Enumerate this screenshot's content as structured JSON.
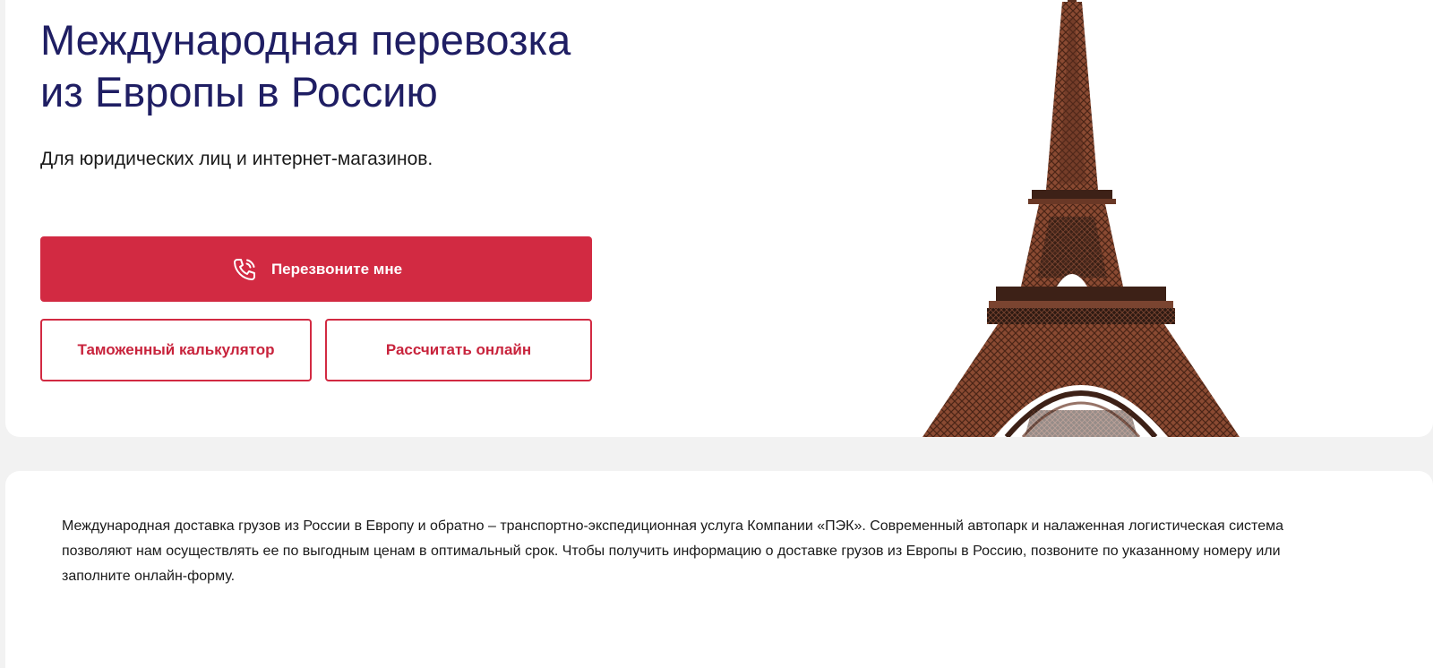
{
  "hero": {
    "title_line1": "Международная перевозка",
    "title_line2": "из Европы в Россию",
    "subtitle": "Для юридических лиц и интернет-магазинов.",
    "callback_button": "Перезвоните мне",
    "callback_icon": "phone-ringing-icon",
    "customs_calculator_button": "Таможенный калькулятор",
    "calculate_online_button": "Рассчитать онлайн",
    "image": "eiffel-tower"
  },
  "info": {
    "text": "Международная доставка грузов из России в Европу и обратно – транспортно-экспедиционная услуга Компании «ПЭК». Современный автопарк и налаженная логистическая система позволяют нам осуществлять ее по выгодным ценам в оптимальный срок. Чтобы получить информацию о доставке грузов из Европы в Россию, позвоните по указанному номеру или заполните онлайн-форму."
  },
  "colors": {
    "title": "#1f1e63",
    "accent": "#d22a42",
    "tower": "#8a4a32",
    "page_background": "#f2f2f2"
  }
}
